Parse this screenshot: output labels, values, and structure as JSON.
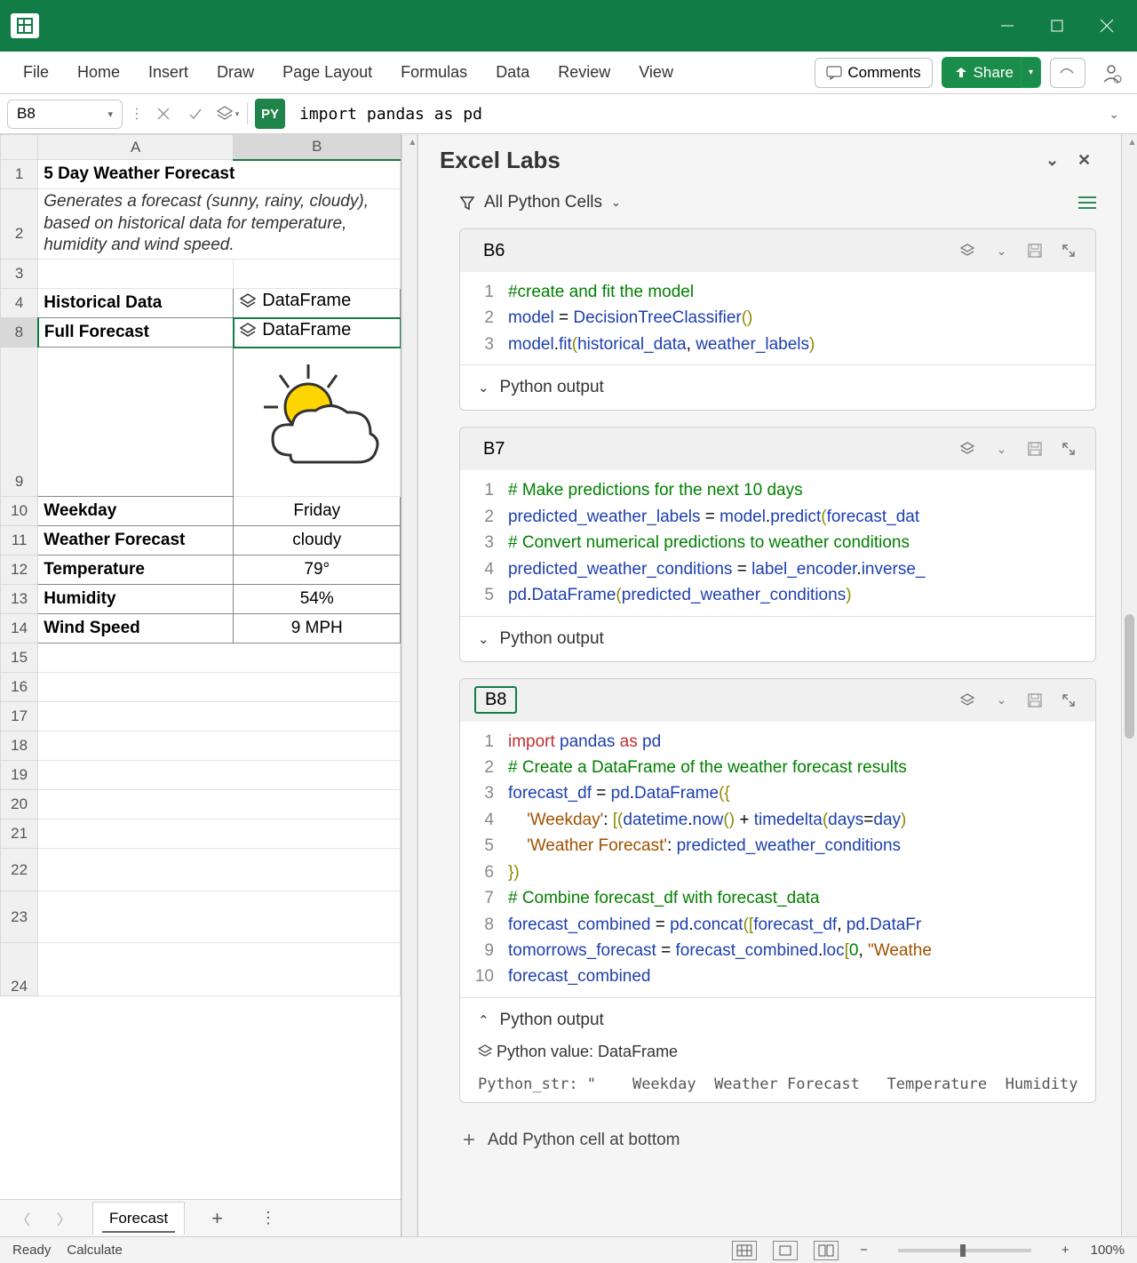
{
  "titlebar": {
    "app": "Excel"
  },
  "ribbon": {
    "tabs": [
      "File",
      "Home",
      "Insert",
      "Draw",
      "Page Layout",
      "Formulas",
      "Data",
      "Review",
      "View"
    ],
    "comments": "Comments",
    "share": "Share"
  },
  "formula_bar": {
    "name_box": "B8",
    "py_badge": "PY",
    "formula": "import pandas as pd"
  },
  "sheet": {
    "columns": [
      "A",
      "B"
    ],
    "rows": [
      "1",
      "2",
      "3",
      "4",
      "8",
      "9",
      "10",
      "11",
      "12",
      "13",
      "14",
      "15",
      "16",
      "17",
      "18",
      "19",
      "20",
      "21",
      "22",
      "23",
      "24"
    ],
    "title": "5 Day Weather Forecast",
    "subtitle": "Generates a forecast (sunny, rainy, cloudy), based on historical data for temperature, humidity and wind speed.",
    "r4a": "Historical Data",
    "r4b": "DataFrame",
    "r8a": "Full Forecast",
    "r8b": "DataFrame",
    "r10a": "Weekday",
    "r10b": "Friday",
    "r11a": "Weather Forecast",
    "r11b": "cloudy",
    "r12a": "Temperature",
    "r12b": "79°",
    "r13a": "Humidity",
    "r13b": "54%",
    "r14a": "Wind Speed",
    "r14b": "9 MPH",
    "tab": "Forecast"
  },
  "labs": {
    "title": "Excel Labs",
    "filter": "All Python Cells",
    "output_label": "Python output",
    "add_cell": "Add Python cell at bottom",
    "cells": [
      {
        "ref": "B6",
        "lines": [
          {
            "n": "1",
            "html": "<span class='c-comment'>#create and fit the model</span>"
          },
          {
            "n": "2",
            "html": "<span class='c-id'>model</span> = <span class='c-fn'>DecisionTreeClassifier</span><span class='c-par'>()</span>"
          },
          {
            "n": "3",
            "html": "<span class='c-id'>model</span>.<span class='c-fn'>fit</span><span class='c-par'>(</span><span class='c-id'>historical_data</span>, <span class='c-id'>weather_labels</span><span class='c-par'>)</span>"
          }
        ],
        "open": false
      },
      {
        "ref": "B7",
        "lines": [
          {
            "n": "1",
            "html": "<span class='c-comment'># Make predictions for the next 10 days</span>"
          },
          {
            "n": "2",
            "html": "<span class='c-id'>predicted_weather_labels</span> = <span class='c-id'>model</span>.<span class='c-fn'>predict</span><span class='c-par'>(</span><span class='c-id'>forecast_dat</span>"
          },
          {
            "n": "3",
            "html": "<span class='c-comment'># Convert numerical predictions to weather conditions</span>"
          },
          {
            "n": "4",
            "html": "<span class='c-id'>predicted_weather_conditions</span> = <span class='c-id'>label_encoder</span>.<span class='c-id'>inverse_</span>"
          },
          {
            "n": "5",
            "html": "<span class='c-id'>pd</span>.<span class='c-fn'>DataFrame</span><span class='c-par'>(</span><span class='c-id'>predicted_weather_conditions</span><span class='c-par'>)</span>"
          }
        ],
        "open": false
      },
      {
        "ref": "B8",
        "active": true,
        "lines": [
          {
            "n": "1",
            "html": "<span class='c-kw'>import</span> <span class='c-id'>pandas</span> <span class='c-kw'>as</span> <span class='c-id'>pd</span>"
          },
          {
            "n": "2",
            "html": "<span class='c-comment'># Create a DataFrame of the weather forecast results</span>"
          },
          {
            "n": "3",
            "html": "<span class='c-id'>forecast_df</span> = <span class='c-id'>pd</span>.<span class='c-fn'>DataFrame</span><span class='c-par'>({</span>"
          },
          {
            "n": "4",
            "html": "    <span class='c-str'>'Weekday'</span>: <span class='c-par'>[(</span><span class='c-id'>datetime</span>.<span class='c-fn'>now</span><span class='c-par'>()</span> + <span class='c-fn'>timedelta</span><span class='c-par'>(</span><span class='c-id'>days</span>=<span class='c-id'>day</span><span class='c-par'>)</span>"
          },
          {
            "n": "5",
            "html": "    <span class='c-str'>'Weather Forecast'</span>: <span class='c-id'>predicted_weather_conditions</span>"
          },
          {
            "n": "6",
            "html": "<span class='c-par'>})</span>"
          },
          {
            "n": "7",
            "html": "<span class='c-comment'># Combine forecast_df with forecast_data</span>"
          },
          {
            "n": "8",
            "html": "<span class='c-id'>forecast_combined</span> = <span class='c-id'>pd</span>.<span class='c-fn'>concat</span><span class='c-par'>([</span><span class='c-id'>forecast_df</span>, <span class='c-id'>pd</span>.<span class='c-id'>DataFr</span>"
          },
          {
            "n": "9",
            "html": "<span class='c-id'>tomorrows_forecast</span> = <span class='c-id'>forecast_combined</span>.<span class='c-id'>loc</span><span class='c-par'>[</span><span class='c-num'>0</span>, <span class='c-str'>\"Weathe</span>"
          },
          {
            "n": "10",
            "html": "<span class='c-id'>forecast_combined</span>"
          }
        ],
        "open": true,
        "py_value": "Python value: DataFrame",
        "py_str": "Python_str: \"    Weekday  Weather Forecast   Temperature  Humidity"
      }
    ]
  },
  "status": {
    "ready": "Ready",
    "calc": "Calculate",
    "zoom": "100%"
  }
}
